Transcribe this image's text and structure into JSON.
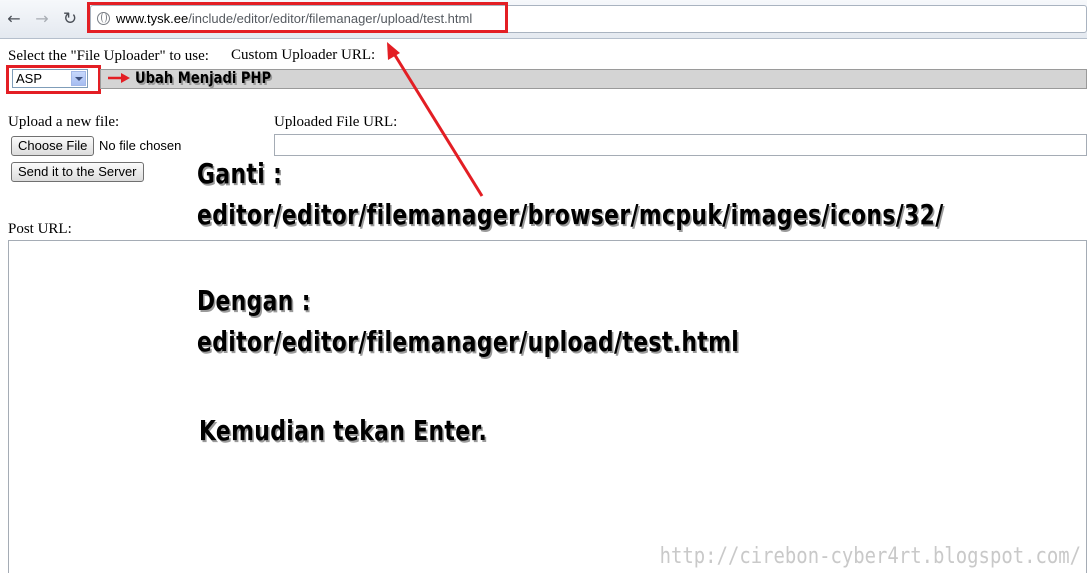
{
  "browser": {
    "url_host": "www.tysk.ee",
    "url_path": "/include/editor/editor/filemanager/upload/test.html"
  },
  "form": {
    "select_label": "Select the \"File Uploader\" to use:",
    "select_value": "ASP",
    "custom_url_label": "Custom Uploader URL:",
    "upload_label": "Upload a new file:",
    "choose_file_button": "Choose File",
    "file_status": "No file chosen",
    "send_button": "Send it to the Server",
    "uploaded_url_label": "Uploaded File URL:",
    "post_url_label": "Post URL:"
  },
  "annotations": {
    "select_note": "Ubah Menjadi PHP",
    "replace_heading": "Ganti :",
    "replace_from": "editor/editor/filemanager/browser/mcpuk/images/icons/32/",
    "with_heading": "Dengan :",
    "replace_to": "editor/editor/filemanager/upload/test.html",
    "enter_note": "Kemudian tekan Enter."
  },
  "watermark": "http://cirebon-cyber4rt.blogspot.com/",
  "colors": {
    "highlight": "#e31e24"
  }
}
